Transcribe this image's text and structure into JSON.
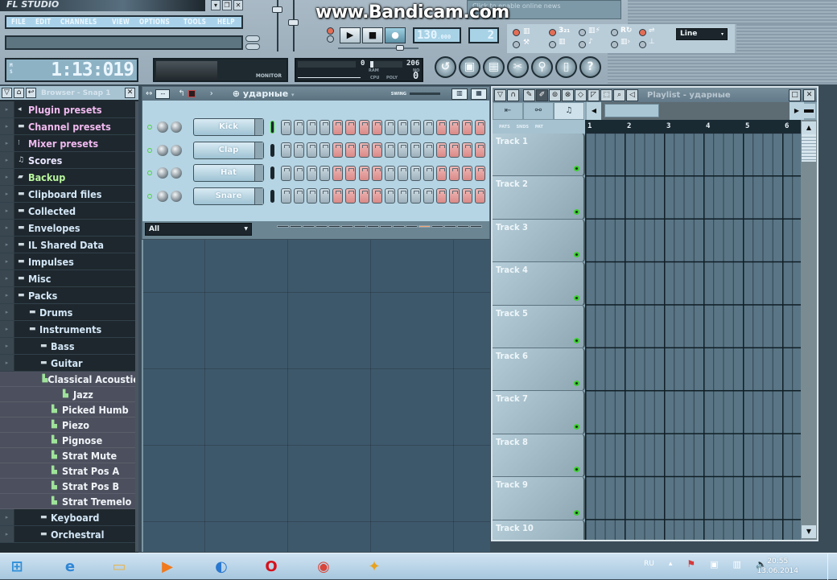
{
  "app": {
    "title": "FL STUDIO",
    "menu": [
      "FILE",
      "EDIT",
      "CHANNELS",
      "VIEW",
      "OPTIONS",
      "TOOLS",
      "HELP"
    ],
    "window_buttons": [
      "minimize",
      "restore",
      "close"
    ],
    "song_time": "1:13:019",
    "time_flags": [
      "M",
      "S"
    ],
    "monitor_label": "MONITOR",
    "news_text": "Click to enable online news",
    "watermark": "www.Bandicam.com"
  },
  "transport": {
    "play_label": "▶",
    "stop_label": "■",
    "record_label": "●",
    "tempo": "130",
    "tempo_frac": ".000",
    "pattern_number": "2",
    "snap": "Line"
  },
  "cpu_panel": {
    "ram_value": "0",
    "voices_value": "206",
    "poly_value": "0",
    "labels": [
      "RAM",
      "CPU",
      "POLY",
      "NO"
    ]
  },
  "tool_buttons": [
    {
      "name": "undo",
      "glyph": "↺"
    },
    {
      "name": "save",
      "glyph": "▣"
    },
    {
      "name": "export",
      "glyph": "▤"
    },
    {
      "name": "cut",
      "glyph": "✂"
    },
    {
      "name": "record-audio",
      "glyph": "⚲"
    },
    {
      "name": "project-info",
      "glyph": "▯"
    },
    {
      "name": "help",
      "glyph": "?"
    }
  ],
  "browser": {
    "title": "Browser - Snap 1",
    "items": [
      {
        "label": "Plugin presets",
        "color": "pink",
        "icon": "◂",
        "type": "folder",
        "indent": 0
      },
      {
        "label": "Channel presets",
        "color": "pink",
        "icon": "▬",
        "type": "folder",
        "indent": 0
      },
      {
        "label": "Mixer presets",
        "color": "pink",
        "icon": "⁝",
        "type": "folder",
        "indent": 0
      },
      {
        "label": "Scores",
        "color": "lav",
        "icon": "♫",
        "type": "folder",
        "indent": 0
      },
      {
        "label": "Backup",
        "color": "green",
        "icon": "▰",
        "type": "folder",
        "indent": 0
      },
      {
        "label": "Clipboard files",
        "color": "blue",
        "icon": "▬",
        "type": "folder",
        "indent": 0
      },
      {
        "label": "Collected",
        "color": "blue",
        "icon": "▬",
        "type": "folder",
        "indent": 0
      },
      {
        "label": "Envelopes",
        "color": "blue",
        "icon": "▬",
        "type": "folder",
        "indent": 0
      },
      {
        "label": "IL Shared Data",
        "color": "blue",
        "icon": "▬",
        "type": "folder",
        "indent": 0
      },
      {
        "label": "Impulses",
        "color": "blue",
        "icon": "▬",
        "type": "folder",
        "indent": 0
      },
      {
        "label": "Misc",
        "color": "blue",
        "icon": "▬",
        "type": "folder",
        "indent": 0
      },
      {
        "label": "Packs",
        "color": "blue",
        "icon": "▬",
        "type": "folder",
        "indent": 0
      },
      {
        "label": "Drums",
        "color": "blue",
        "icon": "▬",
        "type": "folder",
        "indent": 1
      },
      {
        "label": "Instruments",
        "color": "blue",
        "icon": "▬",
        "type": "folder",
        "indent": 1
      },
      {
        "label": "Bass",
        "color": "blue",
        "icon": "▬",
        "type": "folder",
        "indent": 2
      },
      {
        "label": "Guitar",
        "color": "blue",
        "icon": "▬",
        "type": "folder",
        "indent": 2
      },
      {
        "label": "Classical Acoustic",
        "color": "white",
        "icon": "▙",
        "type": "file",
        "indent": 3
      },
      {
        "label": "Jazz",
        "color": "white",
        "icon": "▙",
        "type": "file",
        "indent": 4
      },
      {
        "label": "Picked Humb",
        "color": "white",
        "icon": "▙",
        "type": "file",
        "indent": 3
      },
      {
        "label": "Piezo",
        "color": "white",
        "icon": "▙",
        "type": "file",
        "indent": 3
      },
      {
        "label": "Pignose",
        "color": "white",
        "icon": "▙",
        "type": "file",
        "indent": 3
      },
      {
        "label": "Strat Mute",
        "color": "white",
        "icon": "▙",
        "type": "file",
        "indent": 3
      },
      {
        "label": "Strat Pos A",
        "color": "white",
        "icon": "▙",
        "type": "file",
        "indent": 3
      },
      {
        "label": "Strat Pos B",
        "color": "white",
        "icon": "▙",
        "type": "file",
        "indent": 3
      },
      {
        "label": "Strat Tremelo",
        "color": "white",
        "icon": "▙",
        "type": "file",
        "indent": 3
      },
      {
        "label": "Keyboard",
        "color": "blue",
        "icon": "▬",
        "type": "folder",
        "indent": 2
      },
      {
        "label": "Orchestral",
        "color": "blue",
        "icon": "▬",
        "type": "folder",
        "indent": 2
      }
    ]
  },
  "channel_rack": {
    "pattern_name": "ударные",
    "swing_label": "SWING",
    "filter": "All",
    "current_step": 12,
    "channels": [
      {
        "name": "Kick",
        "selected": true,
        "steps": [
          0,
          0,
          0,
          0,
          0,
          0,
          0,
          0,
          0,
          0,
          0,
          0,
          0,
          0,
          0,
          0
        ]
      },
      {
        "name": "Clap",
        "selected": false,
        "steps": [
          0,
          0,
          0,
          0,
          0,
          0,
          0,
          0,
          0,
          0,
          0,
          0,
          0,
          0,
          0,
          0
        ]
      },
      {
        "name": "Hat",
        "selected": false,
        "steps": [
          0,
          0,
          0,
          0,
          0,
          0,
          0,
          0,
          0,
          0,
          0,
          0,
          0,
          0,
          0,
          0
        ]
      },
      {
        "name": "Snare",
        "selected": false,
        "steps": [
          0,
          0,
          0,
          0,
          0,
          0,
          0,
          0,
          0,
          0,
          0,
          0,
          0,
          0,
          0,
          0
        ]
      }
    ]
  },
  "playlist": {
    "title": "Playlist - ударные",
    "ruler_left_labels": "PATS SNDS PAT",
    "bars": [
      "1",
      "2",
      "3",
      "4",
      "5",
      "6"
    ],
    "tracks": [
      "Track 1",
      "Track 2",
      "Track 3",
      "Track 4",
      "Track 5",
      "Track 6",
      "Track 7",
      "Track 8",
      "Track 9",
      "Track 10"
    ]
  },
  "taskbar": {
    "items": [
      {
        "name": "start",
        "glyph": "⊞",
        "color": "#2f8fd8"
      },
      {
        "name": "internet-explorer",
        "glyph": "e",
        "color": "#2e86d6"
      },
      {
        "name": "explorer",
        "glyph": "▭",
        "color": "#e8b44c"
      },
      {
        "name": "media-player",
        "glyph": "▶",
        "color": "#f07a1c"
      },
      {
        "name": "network-app",
        "glyph": "◐",
        "color": "#2a78cf"
      },
      {
        "name": "opera",
        "glyph": "O",
        "color": "#d6121c"
      },
      {
        "name": "chrome",
        "glyph": "◉",
        "color": "#d8453a"
      },
      {
        "name": "fl-studio",
        "glyph": "✦",
        "color": "#e7a21e"
      }
    ],
    "language": "RU",
    "time": "20:55",
    "date": "13.06.2014"
  }
}
